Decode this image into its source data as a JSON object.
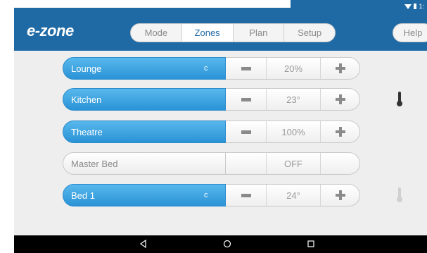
{
  "app": {
    "logo_text": "e-zone",
    "accent": "#1f6aa5",
    "zone_on_color": "#3aa3e2"
  },
  "status_bar": {
    "time_fragment": "1:",
    "icons": [
      "wifi-icon",
      "battery-icon"
    ]
  },
  "tabs": [
    {
      "label": "Mode",
      "active": false
    },
    {
      "label": "Zones",
      "active": true
    },
    {
      "label": "Plan",
      "active": false
    },
    {
      "label": "Setup",
      "active": false
    }
  ],
  "help_label": "Help",
  "zones": [
    {
      "name": "Lounge",
      "on": true,
      "indicator": "c",
      "value": "20%",
      "controls": true,
      "thermometer": "none"
    },
    {
      "name": "Kitchen",
      "on": true,
      "indicator": "",
      "value": "23°",
      "controls": true,
      "thermometer": "dark"
    },
    {
      "name": "Theatre",
      "on": true,
      "indicator": "",
      "value": "100%",
      "controls": true,
      "thermometer": "none"
    },
    {
      "name": "Master Bed",
      "on": false,
      "indicator": "",
      "value": "OFF",
      "controls": false,
      "thermometer": "none"
    },
    {
      "name": "Bed 1",
      "on": true,
      "indicator": "c",
      "value": "24°",
      "controls": true,
      "thermometer": "light"
    }
  ],
  "nav_icons": [
    "back-icon",
    "home-icon",
    "recents-icon"
  ]
}
